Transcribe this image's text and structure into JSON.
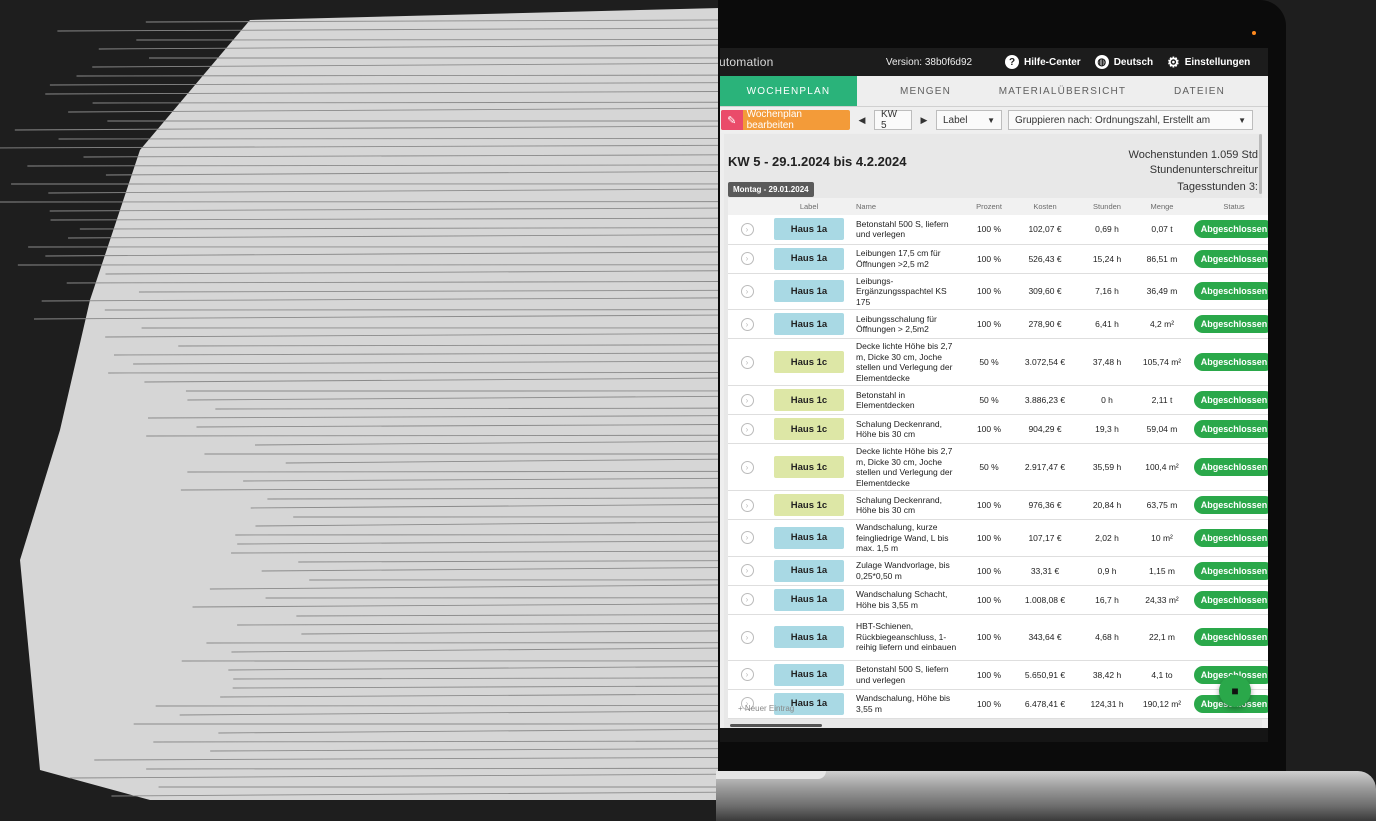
{
  "app_bar": {
    "title": "utomation",
    "version": "Version: 38b0f6d92",
    "help": "Hilfe-Center",
    "language": "Deutsch",
    "settings": "Einstellungen"
  },
  "tabs": [
    {
      "label": "WOCHENPLAN"
    },
    {
      "label": "MENGEN"
    },
    {
      "label": "MATERIALÜBERSICHT"
    },
    {
      "label": "DATEIEN"
    }
  ],
  "toolbar": {
    "edit_label": "Wochenplan bearbeiten",
    "week": "KW 5",
    "label_select": "Label",
    "group_select": "Gruppieren nach: Ordnungszahl, Erstellt am"
  },
  "week": {
    "heading": "KW 5 - 29.1.2024 bis 4.2.2024",
    "hours": "Wochenstunden 1.059 Std",
    "under": "Stundenunterschreitur",
    "day_chip": "Montag - 29.01.2024",
    "day_hours": "Tagesstunden 3:"
  },
  "table": {
    "headers": [
      "Label",
      "Name",
      "Prozent",
      "Kosten",
      "Stunden",
      "Menge",
      "Status"
    ],
    "rows": [
      {
        "label": "Haus 1a",
        "name": "Betonstahl 500 S, liefern und verlegen",
        "pct": "100 %",
        "cost": "102,07 €",
        "hours": "0,69 h",
        "qty": "0,07 t",
        "status": "Abgeschlossen"
      },
      {
        "label": "Haus 1a",
        "name": "Leibungen 17,5 cm für Öffnungen >2,5 m2",
        "pct": "100 %",
        "cost": "526,43 €",
        "hours": "15,24 h",
        "qty": "86,51 m",
        "status": "Abgeschlossen"
      },
      {
        "label": "Haus 1a",
        "name": "Leibungs-Ergänzungsspachtel KS 175",
        "pct": "100 %",
        "cost": "309,60 €",
        "hours": "7,16 h",
        "qty": "36,49 m",
        "status": "Abgeschlossen"
      },
      {
        "label": "Haus 1a",
        "name": "Leibungsschalung für Öffnungen > 2,5m2",
        "pct": "100 %",
        "cost": "278,90 €",
        "hours": "6,41 h",
        "qty": "4,2 m²",
        "status": "Abgeschlossen"
      },
      {
        "label": "Haus 1c",
        "name": "Decke lichte Höhe bis 2,7 m, Dicke 30 cm, Joche stellen und Verlegung der Elementdecke",
        "pct": "50 %",
        "cost": "3.072,54 €",
        "hours": "37,48 h",
        "qty": "105,74 m²",
        "status": "Abgeschlossen"
      },
      {
        "label": "Haus 1c",
        "name": "Betonstahl in Elementdecken",
        "pct": "50 %",
        "cost": "3.886,23 €",
        "hours": "0 h",
        "qty": "2,11 t",
        "status": "Abgeschlossen"
      },
      {
        "label": "Haus 1c",
        "name": "Schalung Deckenrand, Höhe bis 30 cm",
        "pct": "100 %",
        "cost": "904,29 €",
        "hours": "19,3 h",
        "qty": "59,04 m",
        "status": "Abgeschlossen"
      },
      {
        "label": "Haus 1c",
        "name": "Decke lichte Höhe bis 2,7 m, Dicke 30 cm, Joche stellen und Verlegung der Elementdecke",
        "pct": "50 %",
        "cost": "2.917,47 €",
        "hours": "35,59 h",
        "qty": "100,4 m²",
        "status": "Abgeschlossen"
      },
      {
        "label": "Haus 1c",
        "name": "Schalung Deckenrand, Höhe bis 30 cm",
        "pct": "100 %",
        "cost": "976,36 €",
        "hours": "20,84 h",
        "qty": "63,75 m",
        "status": "Abgeschlossen"
      },
      {
        "label": "Haus 1a",
        "name": "Wandschalung, kurze feingliedrige Wand, L bis max. 1,5 m",
        "pct": "100 %",
        "cost": "107,17 €",
        "hours": "2,02 h",
        "qty": "10 m²",
        "status": "Abgeschlossen"
      },
      {
        "label": "Haus 1a",
        "name": "Zulage Wandvorlage, bis 0,25*0,50 m",
        "pct": "100 %",
        "cost": "33,31 €",
        "hours": "0,9 h",
        "qty": "1,15 m",
        "status": "Abgeschlossen"
      },
      {
        "label": "Haus 1a",
        "name": "Wandschalung Schacht, Höhe bis 3,55 m",
        "pct": "100 %",
        "cost": "1.008,08 €",
        "hours": "16,7 h",
        "qty": "24,33 m²",
        "status": "Abgeschlossen"
      },
      {
        "label": "Haus 1a",
        "name": "HBT-Schienen, Rückbiegeanschluss, 1-reihig liefern und einbauen",
        "pct": "100 %",
        "cost": "343,64 €",
        "hours": "4,68 h",
        "qty": "22,1 m",
        "status": "Abgeschlossen"
      },
      {
        "label": "Haus 1a",
        "name": "Betonstahl 500 S, liefern und verlegen",
        "pct": "100 %",
        "cost": "5.650,91 €",
        "hours": "38,42 h",
        "qty": "4,1 to",
        "status": "Abgeschlossen"
      },
      {
        "label": "Haus 1a",
        "name": "Wandschalung, Höhe bis 3,55 m",
        "pct": "100 %",
        "cost": "6.478,41 €",
        "hours": "124,31 h",
        "qty": "190,12 m²",
        "status": "Abgeschlossen"
      }
    ]
  },
  "new_entry": "+ Neuer Eintrag",
  "colors": {
    "accent": "#2ab37a",
    "status_green": "#2aa84a",
    "label_1a": "#a9d9e4",
    "label_1c": "#dde7a6",
    "edit_orange": "#f39b39",
    "edit_pink": "#ea4b6a"
  },
  "icons": {
    "help": "help-circle-icon",
    "language": "globe-icon",
    "settings": "gear-icon",
    "edit": "pencil-icon",
    "save": "floppy-disk-icon"
  }
}
